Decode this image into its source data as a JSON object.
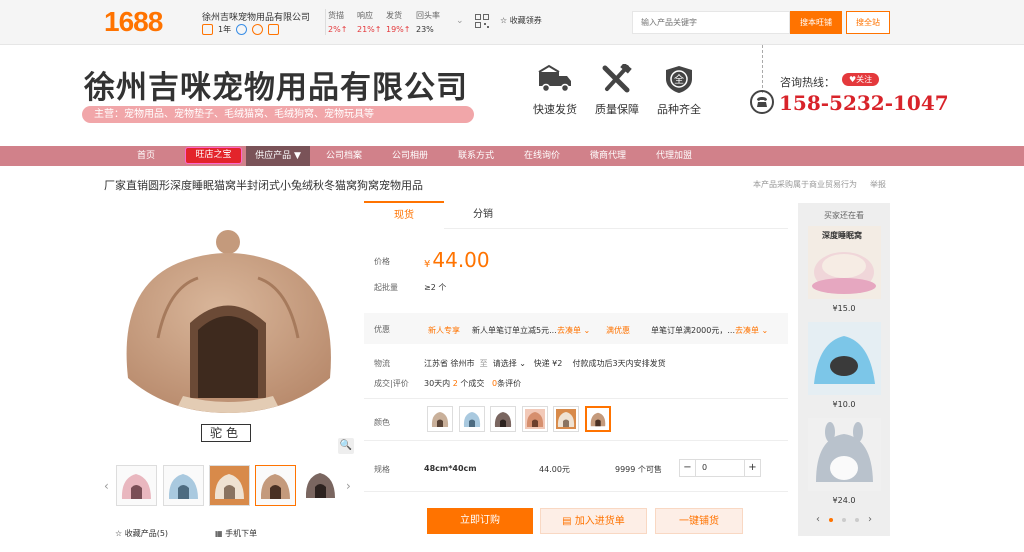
{
  "topbar": {
    "logo": "1688",
    "shop_name": "徐州吉咪宠物用品有限公司",
    "years": "1年",
    "stats": [
      {
        "label": "货描",
        "value": "2%↑"
      },
      {
        "label": "响应",
        "value": "21%↑"
      },
      {
        "label": "发货",
        "value": "19%↑"
      },
      {
        "label": "回头率",
        "value": "23%"
      }
    ],
    "collect": "收藏领券",
    "search_placeholder": "输入产品关键字",
    "search_button": "搜本旺铺",
    "search_all": "搜全站"
  },
  "header": {
    "company": "徐州吉咪宠物用品有限公司",
    "main_business": "主营：宠物用品、宠物垫子、毛绒猫窝、毛绒狗窝、宠物玩具等",
    "features": [
      "快速发货",
      "质量保障",
      "品种齐全"
    ],
    "hotline_label": "咨询热线：",
    "follow": "♥关注",
    "phone": "158-5232-1047"
  },
  "nav": {
    "items": [
      "首页",
      "旺店之宝",
      "供应产品 ▼",
      "公司档案",
      "公司相册",
      "联系方式",
      "在线询价",
      "微商代理",
      "代理加盟"
    ]
  },
  "product": {
    "title": "厂家直销圆形深度睡眠猫窝半封闭式小兔绒秋冬猫窝狗窝宠物用品",
    "note": "本产品采购属于商业贸易行为",
    "report": "举报",
    "color_label": "驼色",
    "fav": "收藏产品(5)",
    "mobile": "手机下单",
    "tabs": [
      "现货",
      "分销"
    ],
    "price_label": "价格",
    "currency": "¥",
    "price": "44.00",
    "moq_label": "起批量",
    "moq": "≥2 个",
    "promo_label": "优惠",
    "promo1_tag": "新人专享",
    "promo1_text": "新人单笔订单立减5元...",
    "promo1_link": "去凑单 ⌄",
    "promo2_tag": "满优惠",
    "promo2_text": "单笔订单满2000元，...",
    "promo2_link": "去凑单 ⌄",
    "logistics_label": "物流",
    "from": "江苏省 徐州市",
    "to_word": "至",
    "to": "请选择 ⌄",
    "express": "快递 ¥2",
    "ship_note": "付款成功后3天内安排发货",
    "trade_label": "成交|评价",
    "trade_pre": "30天内",
    "trade_count": "2",
    "trade_mid": "个成交",
    "review_count": "0",
    "review_text": "条评价",
    "color_row_label": "颜色",
    "spec_label": "规格",
    "spec_size": "48cm*40cm",
    "spec_price": "44.00元",
    "spec_stock": "9999 个可售",
    "qty": "0",
    "btn_order": "立即订购",
    "btn_cart": "加入进货单",
    "btn_dist": "一键铺货"
  },
  "rail": {
    "title": "买家还在看",
    "items": [
      {
        "caption": "深度睡眠窝",
        "price": "¥15.0"
      },
      {
        "caption": "",
        "price": "¥10.0"
      },
      {
        "caption": "",
        "price": "¥24.0"
      }
    ]
  },
  "colors": {
    "accent": "#ff7300",
    "nav_bg": "#d1818a",
    "phone": "#d8232a"
  }
}
